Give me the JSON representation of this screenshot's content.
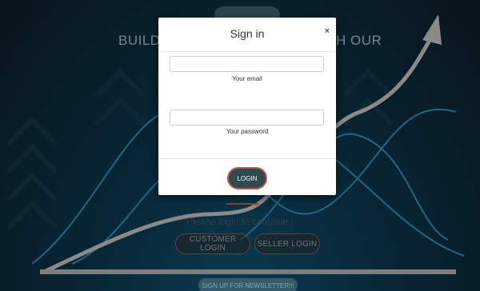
{
  "hero": {
    "heading_left": "BUILD",
    "heading_right": "H OUR",
    "prompt": "Please login to continue !",
    "customer_login_label": "CUSTOMER LOGIN",
    "seller_login_label": "SELLER LOGIN",
    "newsletter_label": "SIGN UP FOR NEWSLETTER!!!"
  },
  "modal": {
    "title": "Sign in",
    "close_symbol": "×",
    "email_label": "Your email",
    "email_value": "",
    "password_label": "Your password",
    "password_value": "",
    "login_label": "LOGIN"
  },
  "colors": {
    "login_button_bg": "#2e4a4f",
    "login_button_border": "#b35c4c",
    "background_dark": "#0a2f42"
  }
}
